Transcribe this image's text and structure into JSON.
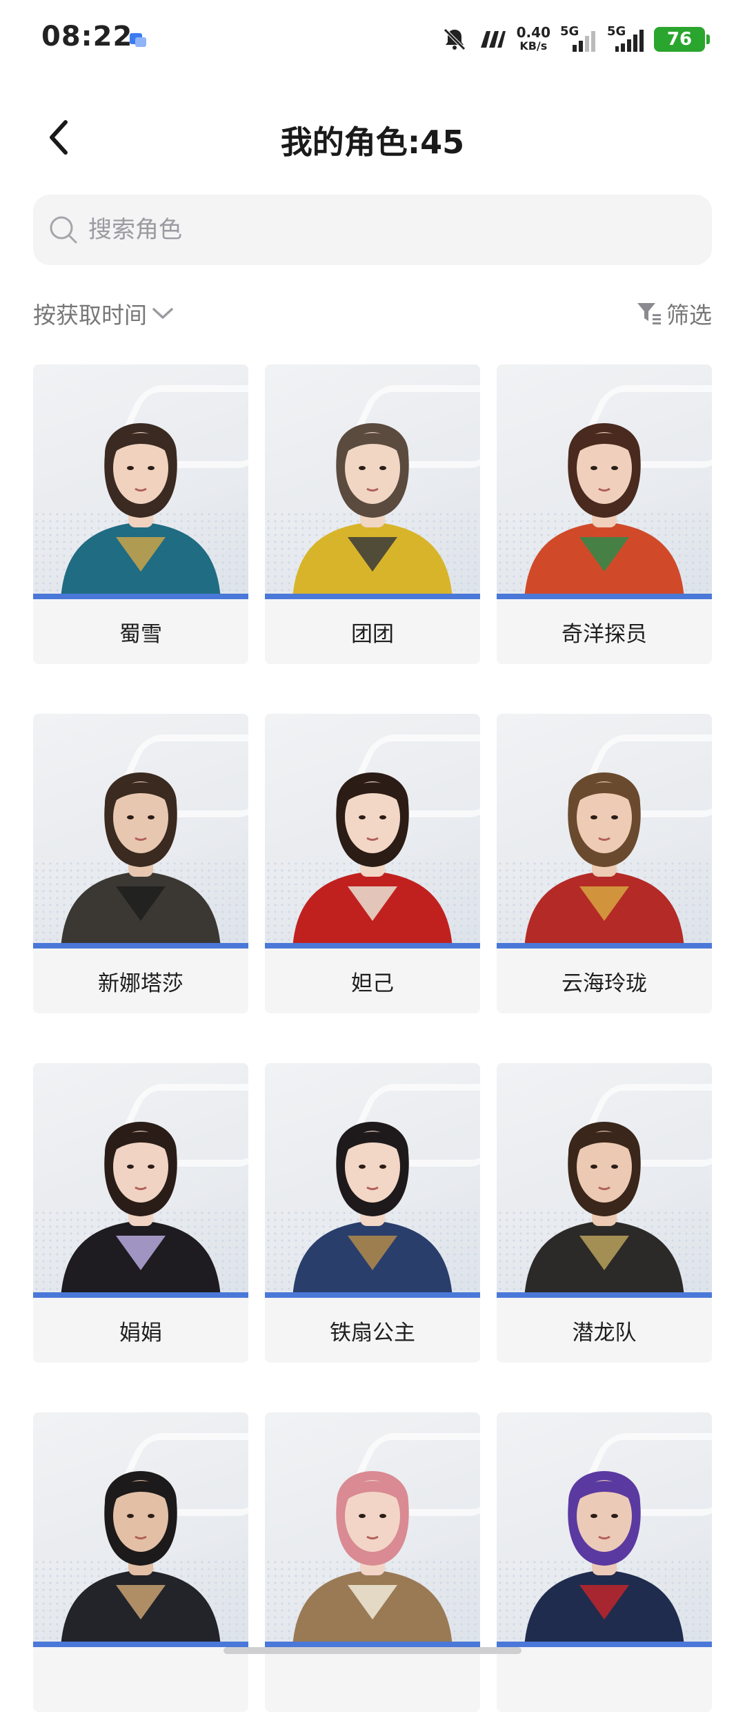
{
  "status_bar": {
    "time": "08:22",
    "net_speed_value": "0.40",
    "net_speed_unit": "KB/s",
    "sim1_label": "5G",
    "sim2_label": "5G",
    "battery": "76",
    "battery_color": "#2aa52e"
  },
  "header": {
    "title": "我的角色:45"
  },
  "search": {
    "placeholder": "搜索角色",
    "value": ""
  },
  "toolbar": {
    "sort_label": "按获取时间",
    "filter_label": "筛选"
  },
  "accent_color": "#4a78d8",
  "characters": [
    {
      "name": "蜀雪",
      "hair": "#3a2a22",
      "outfit": "#1f6c83",
      "accent": "#c9a34a",
      "skin": "#f0d2bf"
    },
    {
      "name": "团团",
      "hair": "#5b4a3e",
      "outfit": "#d8b42a",
      "accent": "#3a3a3a",
      "skin": "#f1d6c4"
    },
    {
      "name": "奇洋探员",
      "hair": "#4a2a1e",
      "outfit": "#d04a2a",
      "accent": "#2f8a4a",
      "skin": "#f0d0bc"
    },
    {
      "name": "新娜塔莎",
      "hair": "#3a2a20",
      "outfit": "#3b3833",
      "accent": "#1e1e1e",
      "skin": "#e8c7b1"
    },
    {
      "name": "妲己",
      "hair": "#2b1c16",
      "outfit": "#c0211f",
      "accent": "#e9e2d5",
      "skin": "#f3d7c6"
    },
    {
      "name": "云海玲珑",
      "hair": "#6a4a2e",
      "outfit": "#b42a26",
      "accent": "#d6a640",
      "skin": "#edcbb4"
    },
    {
      "name": "娟娟",
      "hair": "#2a1d17",
      "outfit": "#1e1c20",
      "accent": "#b7aadf",
      "skin": "#f0d3c2"
    },
    {
      "name": "铁扇公主",
      "hair": "#1e1a1c",
      "outfit": "#2a3e6c",
      "accent": "#b08a4a",
      "skin": "#f2d6c6"
    },
    {
      "name": "潜龙队",
      "hair": "#3a261a",
      "outfit": "#2c2a28",
      "accent": "#b8a05a",
      "skin": "#ebc9b2"
    },
    {
      "name": "",
      "hair": "#1c1a1a",
      "outfit": "#22242a",
      "accent": "#c8a070",
      "skin": "#e2bfa5"
    },
    {
      "name": "",
      "hair": "#d98a92",
      "outfit": "#9a7a55",
      "accent": "#f0ead8",
      "skin": "#f2d5c7"
    },
    {
      "name": "",
      "hair": "#5a3aa0",
      "outfit": "#1f2c4e",
      "accent": "#c0262c",
      "skin": "#eccab8"
    }
  ]
}
